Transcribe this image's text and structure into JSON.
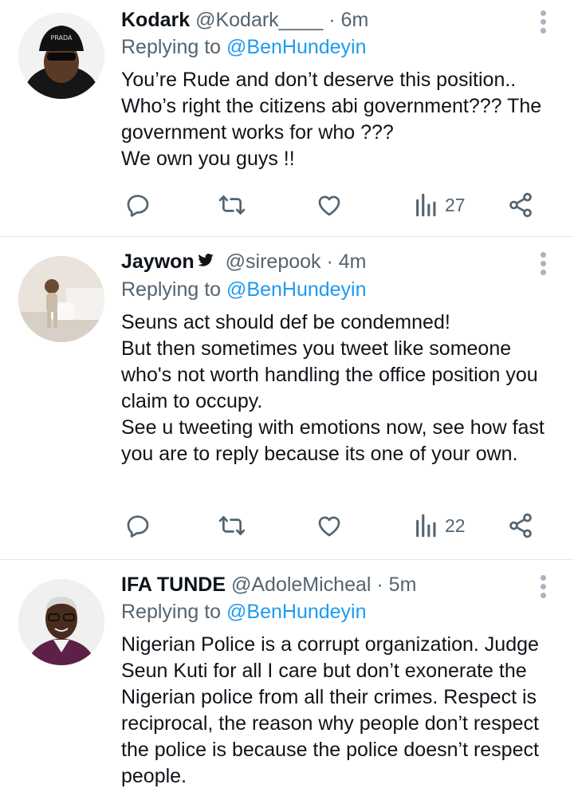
{
  "tweets": [
    {
      "name": "Kodark",
      "handle": "@Kodark____",
      "time": "· 6m",
      "replying_prefix": "Replying to",
      "replying_to": "@BenHundeyin",
      "text": "You’re Rude and don’t deserve this position..\nWho’s right the citizens abi government??? The government works for who ???\nWe own you guys !!",
      "views": "27",
      "verified_icon": false
    },
    {
      "name": "Jaywon",
      "handle": "@sirepook",
      "time": "· 4m",
      "replying_prefix": "Replying to",
      "replying_to": "@BenHundeyin",
      "text": "Seuns act should def be condemned!\nBut then sometimes you tweet like someone who's not worth handling the office position you claim to occupy.\nSee u tweeting with emotions now, see how fast you are to reply because its one of your own.",
      "views": "22",
      "verified_icon": true
    },
    {
      "name": "IFA TUNDE",
      "handle": "@AdoleMicheal",
      "time": "· 5m",
      "replying_prefix": "Replying to",
      "replying_to": "@BenHundeyin",
      "text": "Nigerian Police is a corrupt organization. Judge Seun Kuti for all I care but don’t exonerate the Nigerian police from all their crimes. Respect is reciprocal, the reason why people don’t respect the police is because the police doesn’t respect people.",
      "verified_icon": false
    }
  ],
  "icons": {
    "reply": "reply-icon",
    "retweet": "retweet-icon",
    "like": "like-icon",
    "views": "views-icon",
    "share": "share-icon",
    "more": "more-options-icon"
  }
}
